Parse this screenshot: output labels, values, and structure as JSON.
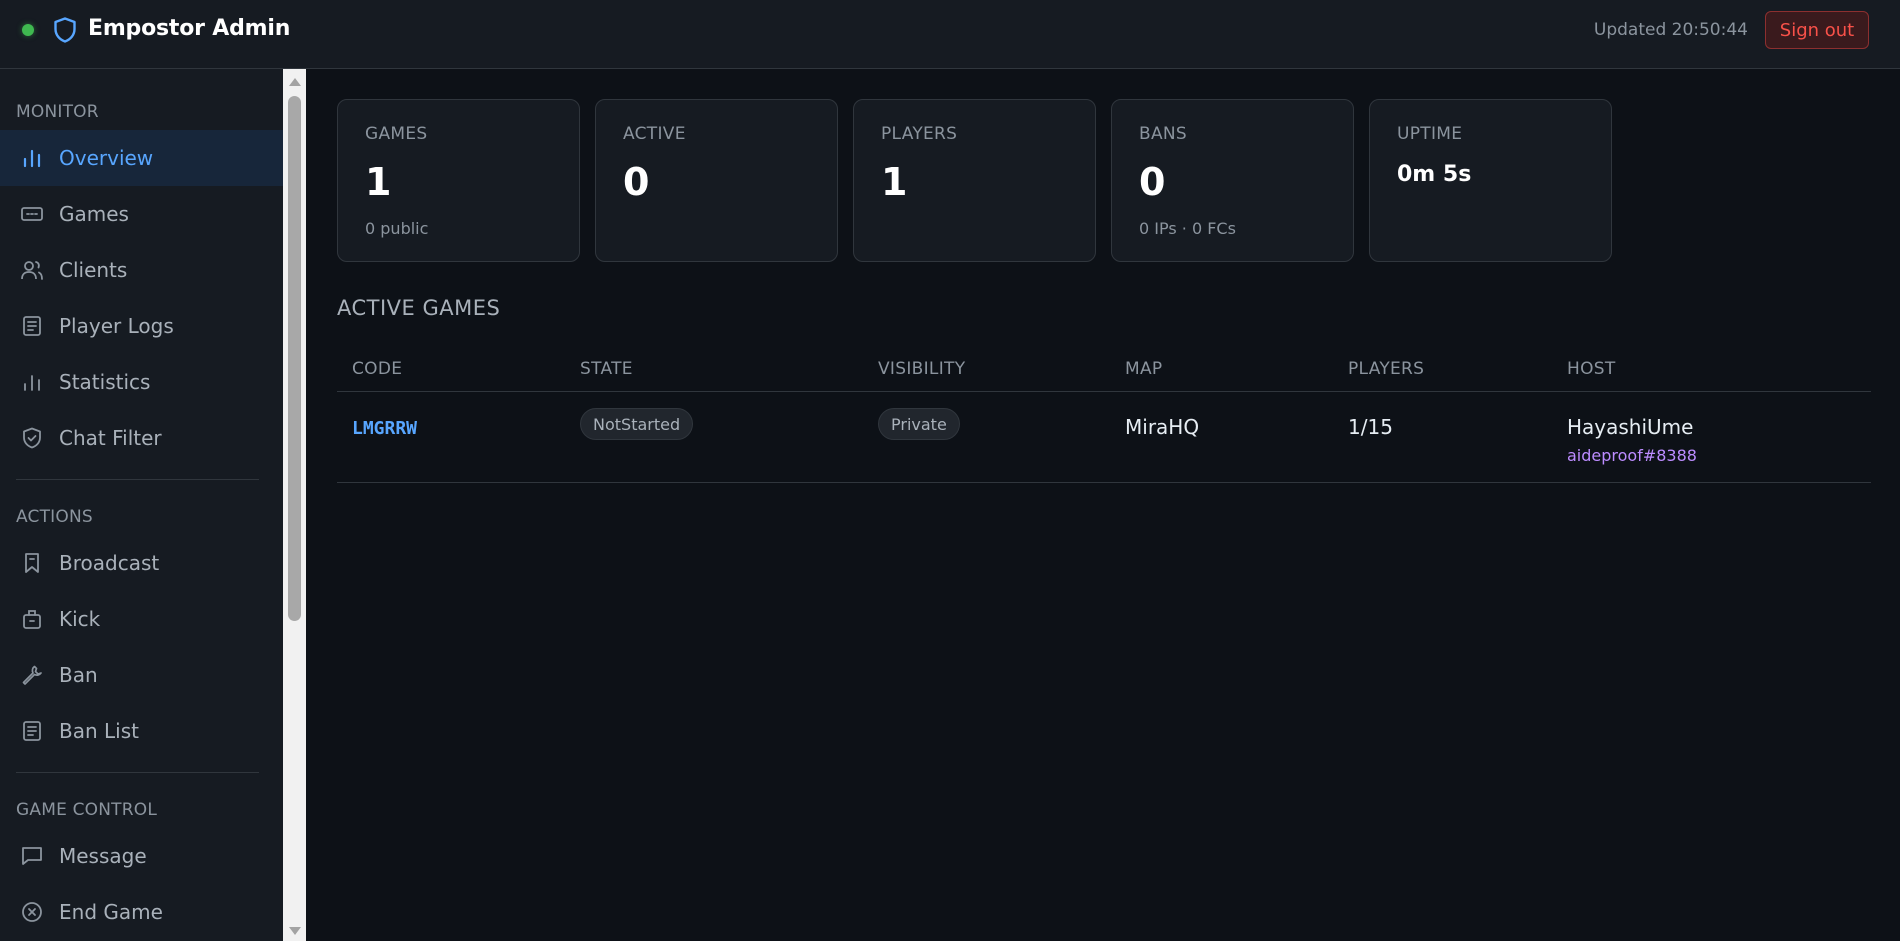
{
  "header": {
    "brand": "Empostor Admin",
    "updated": "Updated 20:50:44",
    "signout_label": "Sign out"
  },
  "sidebar": {
    "sections": [
      {
        "title": "MONITOR",
        "items": [
          {
            "label": "Overview",
            "icon": "bar-chart-icon",
            "active": true
          },
          {
            "label": "Games",
            "icon": "gamepad-icon"
          },
          {
            "label": "Clients",
            "icon": "users-icon"
          },
          {
            "label": "Player Logs",
            "icon": "document-icon"
          },
          {
            "label": "Statistics",
            "icon": "bar-chart-icon"
          },
          {
            "label": "Chat Filter",
            "icon": "shield-check-icon"
          }
        ]
      },
      {
        "title": "ACTIONS",
        "items": [
          {
            "label": "Broadcast",
            "icon": "bookmark-icon"
          },
          {
            "label": "Kick",
            "icon": "briefcase-icon"
          },
          {
            "label": "Ban",
            "icon": "wrench-icon"
          },
          {
            "label": "Ban List",
            "icon": "document-icon"
          }
        ]
      },
      {
        "title": "GAME CONTROL",
        "items": [
          {
            "label": "Message",
            "icon": "message-icon"
          },
          {
            "label": "End Game",
            "icon": "close-circle-icon"
          }
        ]
      }
    ]
  },
  "stats": [
    {
      "label": "GAMES",
      "value": "1",
      "sub": "0 public"
    },
    {
      "label": "ACTIVE",
      "value": "0",
      "sub": ""
    },
    {
      "label": "PLAYERS",
      "value": "1",
      "sub": ""
    },
    {
      "label": "BANS",
      "value": "0",
      "sub": "0 IPs · 0 FCs"
    },
    {
      "label": "UPTIME",
      "value": "0m 5s",
      "sub": ""
    }
  ],
  "active_games": {
    "title": "ACTIVE GAMES",
    "columns": [
      "CODE",
      "STATE",
      "VISIBILITY",
      "MAP",
      "PLAYERS",
      "HOST"
    ],
    "rows": [
      {
        "code": "LMGRRW",
        "state": "NotStarted",
        "visibility": "Private",
        "map": "MiraHQ",
        "players": "1/15",
        "host": "HayashiUme",
        "host_sub": "aideproof#8388"
      }
    ]
  },
  "colors": {
    "accent": "#58a6ff",
    "danger": "#f85149",
    "success": "#3fb950",
    "host_tag": "#bc8cff"
  }
}
